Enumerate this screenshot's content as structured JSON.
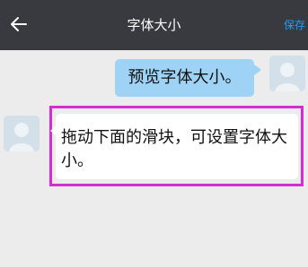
{
  "header": {
    "title": "字体大小",
    "save_label": "保存",
    "back_icon": "arrow-left-icon"
  },
  "messages": [
    {
      "sender": "self",
      "text": "预览字体大小。"
    },
    {
      "sender": "friend",
      "text": "拖动下面的滑块，可设置字体大小。"
    }
  ],
  "colors": {
    "titlebar": "#393a3f",
    "save": "#1a9eff",
    "self_bubble": "#9fd3f6",
    "friend_bubble": "#ffffff",
    "highlight": "#d22fd2",
    "background": "#ececec"
  }
}
